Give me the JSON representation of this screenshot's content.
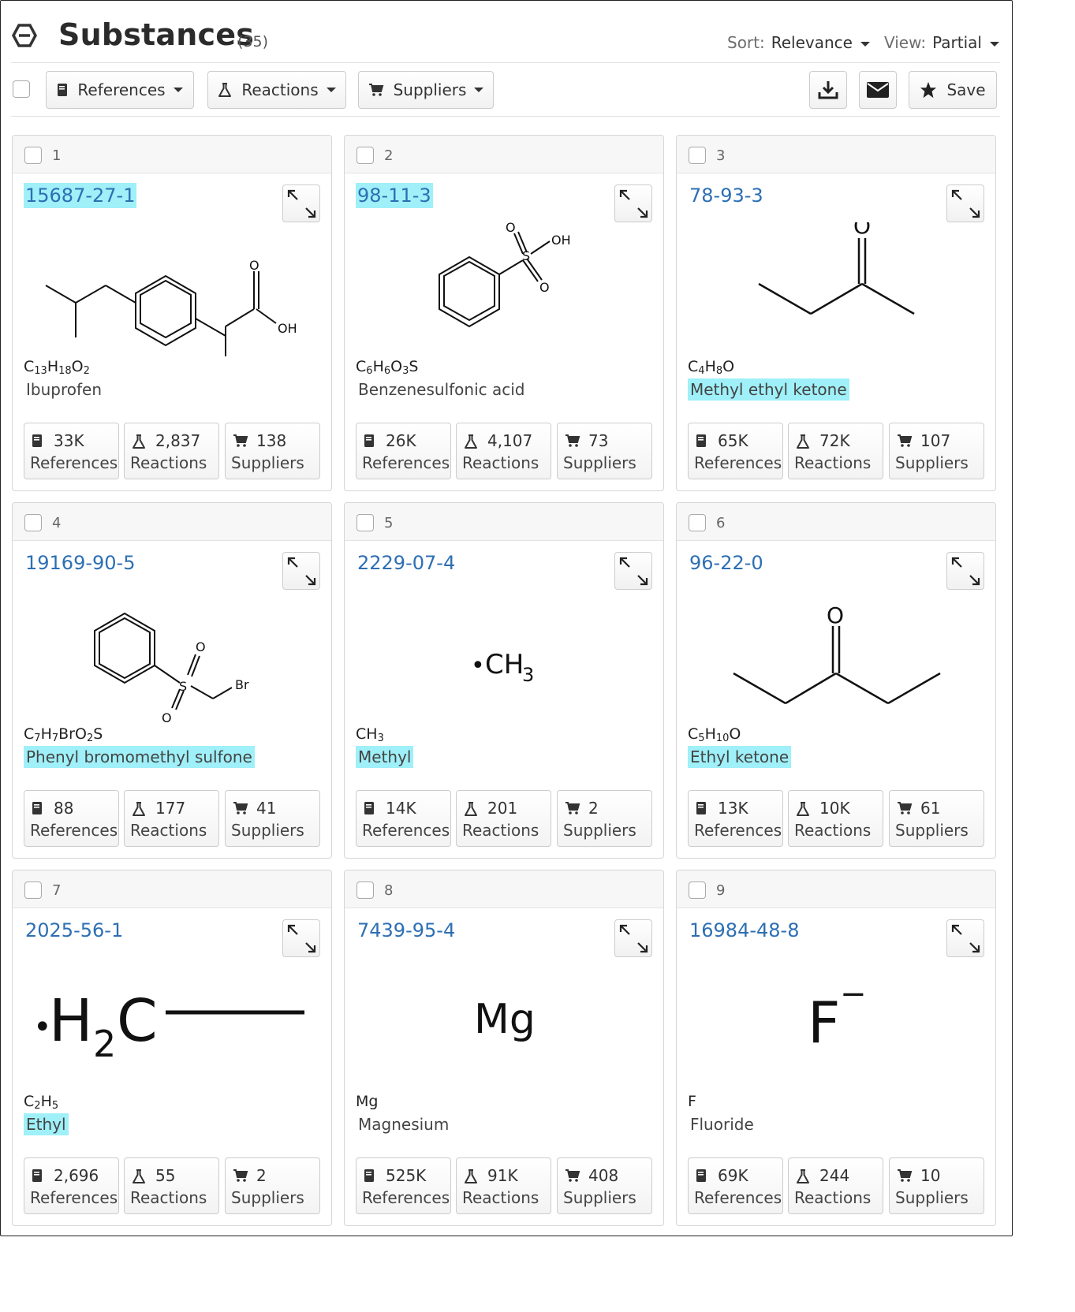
{
  "header": {
    "title": "Substances",
    "count": "(35)",
    "sort_label": "Sort:",
    "sort_value": "Relevance",
    "view_label": "View:",
    "view_value": "Partial"
  },
  "toolbar": {
    "references_label": "References",
    "reactions_label": "Reactions",
    "suppliers_label": "Suppliers",
    "save_label": "Save"
  },
  "stat_labels": {
    "references": "References",
    "reactions": "Reactions",
    "suppliers": "Suppliers"
  },
  "cards": [
    {
      "index": "1",
      "cas": "15687-27-1",
      "cas_highlight": true,
      "formula_html": "C<sub>13</sub>H<sub>18</sub>O<sub>2</sub>",
      "name": "Ibuprofen",
      "name_highlight": false,
      "references": "33K",
      "reactions": "2,837",
      "suppliers": "138"
    },
    {
      "index": "2",
      "cas": "98-11-3",
      "cas_highlight": true,
      "formula_html": "C<sub>6</sub>H<sub>6</sub>O<sub>3</sub>S",
      "name": "Benzenesulfonic acid",
      "name_highlight": false,
      "references": "26K",
      "reactions": "4,107",
      "suppliers": "73"
    },
    {
      "index": "3",
      "cas": "78-93-3",
      "cas_highlight": false,
      "formula_html": "C<sub>4</sub>H<sub>8</sub>O",
      "name": "Methyl ethyl ketone",
      "name_highlight": true,
      "references": "65K",
      "reactions": "72K",
      "suppliers": "107"
    },
    {
      "index": "4",
      "cas": "19169-90-5",
      "cas_highlight": false,
      "formula_html": "C<sub>7</sub>H<sub>7</sub>BrO<sub>2</sub>S",
      "name": "Phenyl bromomethyl sulfone",
      "name_highlight": true,
      "references": "88",
      "reactions": "177",
      "suppliers": "41"
    },
    {
      "index": "5",
      "cas": "2229-07-4",
      "cas_highlight": false,
      "formula_html": "CH<sub>3</sub>",
      "name": "Methyl",
      "name_highlight": true,
      "references": "14K",
      "reactions": "201",
      "suppliers": "2"
    },
    {
      "index": "6",
      "cas": "96-22-0",
      "cas_highlight": false,
      "formula_html": "C<sub>5</sub>H<sub>10</sub>O",
      "name": "Ethyl ketone",
      "name_highlight": true,
      "references": "13K",
      "reactions": "10K",
      "suppliers": "61"
    },
    {
      "index": "7",
      "cas": "2025-56-1",
      "cas_highlight": false,
      "formula_html": "C<sub>2</sub>H<sub>5</sub>",
      "name": "Ethyl",
      "name_highlight": true,
      "references": "2,696",
      "reactions": "55",
      "suppliers": "2"
    },
    {
      "index": "8",
      "cas": "7439-95-4",
      "cas_highlight": false,
      "formula_html": "Mg",
      "name": "Magnesium",
      "name_highlight": false,
      "references": "525K",
      "reactions": "91K",
      "suppliers": "408"
    },
    {
      "index": "9",
      "cas": "16984-48-8",
      "cas_highlight": false,
      "formula_html": "F",
      "name": "Fluoride",
      "name_highlight": false,
      "references": "69K",
      "reactions": "244",
      "suppliers": "10"
    }
  ],
  "structure_text": {
    "ibuprofen_o": "O",
    "ibuprofen_oh": "OH",
    "bsa_o1": "O",
    "bsa_oh": "OH",
    "bsa_s": "S",
    "bsa_o2": "O",
    "mek_o": "O",
    "pbms_o1": "O",
    "pbms_s": "S",
    "pbms_o2": "O",
    "pbms_br": "Br",
    "methyl_dot": "•",
    "methyl_ch": "CH",
    "methyl_sub": "3",
    "ek_o": "O",
    "ethyl_dot": "•",
    "ethyl_h": "H",
    "ethyl_sub": "2",
    "ethyl_c": "C",
    "mg": "Mg",
    "f": "F",
    "f_charge": "−"
  }
}
